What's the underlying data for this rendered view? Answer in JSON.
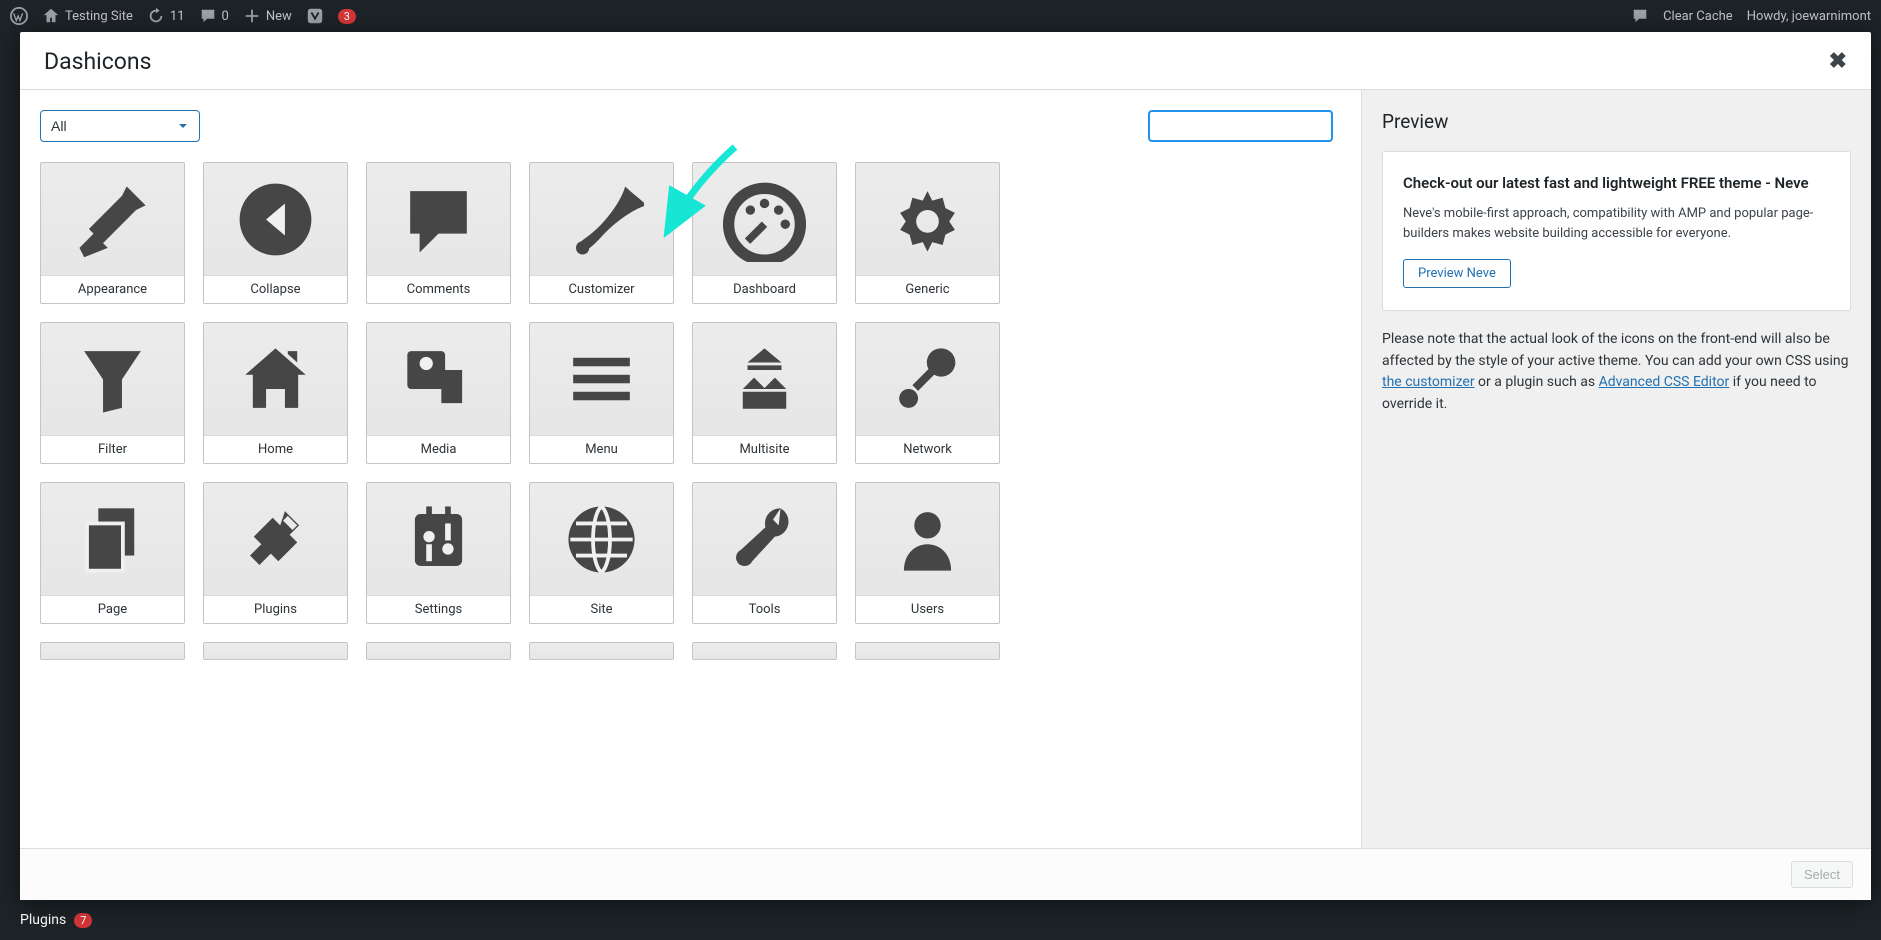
{
  "admin_bar": {
    "site_name": "Testing Site",
    "updates": "11",
    "comments": "0",
    "new": "New",
    "notif": "3",
    "clear_cache": "Clear Cache",
    "howdy": "Howdy, joewarnimont"
  },
  "sidebar": {
    "plugins": "Plugins",
    "plugin_count": "7"
  },
  "modal": {
    "title": "Dashicons",
    "filter_value": "All",
    "search_placeholder": ""
  },
  "icons": [
    {
      "label": "Appearance"
    },
    {
      "label": "Collapse"
    },
    {
      "label": "Comments"
    },
    {
      "label": "Customizer"
    },
    {
      "label": "Dashboard"
    },
    {
      "label": "Generic"
    },
    {
      "label": "Filter"
    },
    {
      "label": "Home"
    },
    {
      "label": "Media"
    },
    {
      "label": "Menu"
    },
    {
      "label": "Multisite"
    },
    {
      "label": "Network"
    },
    {
      "label": "Page"
    },
    {
      "label": "Plugins"
    },
    {
      "label": "Settings"
    },
    {
      "label": "Site"
    },
    {
      "label": "Tools"
    },
    {
      "label": "Users"
    }
  ],
  "preview": {
    "heading": "Preview",
    "card_title": "Check-out our latest fast and lightweight FREE theme - Neve",
    "card_body": "Neve's mobile-first approach, compatibility with AMP and popular page-builders makes website building accessible for everyone.",
    "card_btn": "Preview Neve",
    "note_prefix": "Please note that the actual look of the icons on the front-end will also be affected by the style of your active theme. You can add your own CSS using ",
    "link1": "the customizer",
    "note_mid": " or a plugin such as ",
    "link2": "Advanced CSS Editor",
    "note_suffix": " if you need to override it."
  },
  "footer": {
    "select": "Select"
  }
}
